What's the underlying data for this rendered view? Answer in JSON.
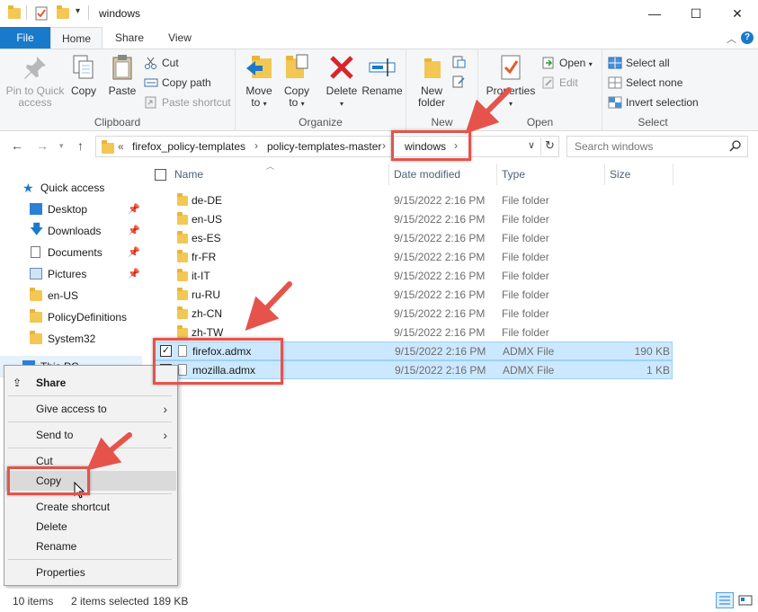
{
  "window": {
    "title": "windows",
    "minimize": "—",
    "maximize": "☐",
    "close": "✕"
  },
  "ribbon_tabs": [
    "File",
    "Home",
    "Share",
    "View"
  ],
  "ribbon": {
    "clipboard": {
      "label": "Clipboard",
      "pin_label": "Pin to Quick access",
      "copy_label": "Copy",
      "paste_label": "Paste",
      "cut_label": "Cut",
      "copy_path_label": "Copy path",
      "paste_shortcut_label": "Paste shortcut"
    },
    "organize": {
      "label": "Organize",
      "move_to": "Move to",
      "copy_to": "Copy to",
      "delete": "Delete",
      "rename": "Rename"
    },
    "new": {
      "label": "New",
      "new_folder": "New folder"
    },
    "open": {
      "label": "Open",
      "properties": "Properties",
      "open": "Open",
      "edit": "Edit"
    },
    "select": {
      "label": "Select",
      "select_all": "Select all",
      "select_none": "Select none",
      "invert": "Invert selection"
    }
  },
  "address": {
    "overflow": "«",
    "crumbs": [
      "firefox_policy-templates",
      "policy-templates-master",
      "windows"
    ],
    "search_placeholder": "Search windows"
  },
  "columns": {
    "name": "Name",
    "date": "Date modified",
    "type": "Type",
    "size": "Size"
  },
  "files": [
    {
      "name": "de-DE",
      "date": "9/15/2022 2:16 PM",
      "type": "File folder",
      "size": ""
    },
    {
      "name": "en-US",
      "date": "9/15/2022 2:16 PM",
      "type": "File folder",
      "size": ""
    },
    {
      "name": "es-ES",
      "date": "9/15/2022 2:16 PM",
      "type": "File folder",
      "size": ""
    },
    {
      "name": "fr-FR",
      "date": "9/15/2022 2:16 PM",
      "type": "File folder",
      "size": ""
    },
    {
      "name": "it-IT",
      "date": "9/15/2022 2:16 PM",
      "type": "File folder",
      "size": ""
    },
    {
      "name": "ru-RU",
      "date": "9/15/2022 2:16 PM",
      "type": "File folder",
      "size": ""
    },
    {
      "name": "zh-CN",
      "date": "9/15/2022 2:16 PM",
      "type": "File folder",
      "size": ""
    },
    {
      "name": "zh-TW",
      "date": "9/15/2022 2:16 PM",
      "type": "File folder",
      "size": ""
    },
    {
      "name": "firefox.admx",
      "date": "9/15/2022 2:16 PM",
      "type": "ADMX File",
      "size": "190 KB"
    },
    {
      "name": "mozilla.admx",
      "date": "9/15/2022 2:16 PM",
      "type": "ADMX File",
      "size": "1 KB"
    }
  ],
  "nav": {
    "quick_access": "Quick access",
    "items": [
      "Desktop",
      "Downloads",
      "Documents",
      "Pictures",
      "en-US",
      "PolicyDefinitions",
      "System32"
    ],
    "this_pc": "This PC"
  },
  "context_menu": {
    "share": "Share",
    "give_access": "Give access to",
    "send_to": "Send to",
    "cut": "Cut",
    "copy": "Copy",
    "create_shortcut": "Create shortcut",
    "delete": "Delete",
    "rename": "Rename",
    "properties": "Properties"
  },
  "status": {
    "items": "10 items",
    "selected": "2 items selected",
    "size": "189 KB"
  },
  "colors": {
    "accent": "#1979ca",
    "selection": "#cce8ff",
    "annotation": "#e5534b",
    "folder": "#f3c754"
  }
}
